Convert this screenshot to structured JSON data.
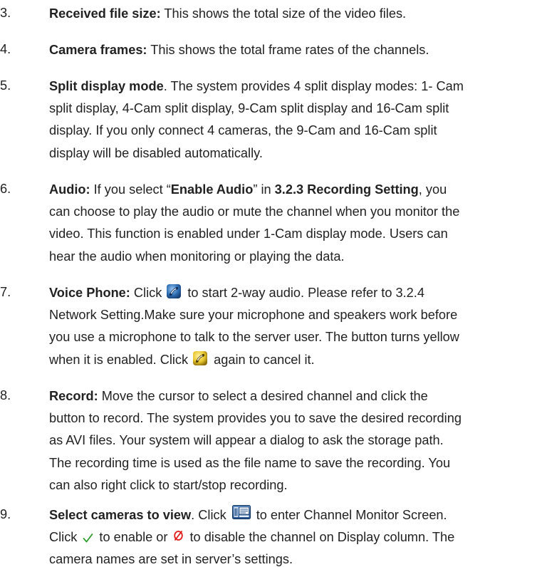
{
  "colors": {
    "text": "#222222",
    "check_green": "#2e9e2e",
    "disable_red": "#e21b1b",
    "phone_blue": "#2f6fb5",
    "phone_yellow": "#e8c62c"
  },
  "icons": {
    "voice_phone": "voice-phone-icon",
    "voice_phone_active": "voice-phone-active-icon",
    "monitor": "channel-monitor-icon",
    "check": "check-icon",
    "disable": "disable-icon"
  },
  "items": [
    {
      "number": "3.",
      "lines": [
        {
          "label": "Received file size:",
          "text": " This shows the total size of the video files."
        }
      ]
    },
    {
      "number": "4.",
      "lines": [
        {
          "label": "Camera frames:",
          "text": " This shows the total frame rates of the channels."
        }
      ]
    },
    {
      "number": "5.",
      "lines": [
        {
          "label": "Split display mode",
          "text": ". The system provides 4 split display modes: 1- Cam"
        },
        {
          "text": "split display, 4-Cam split display, 9-Cam split display and 16-Cam split"
        },
        {
          "text": "display. If you only connect 4 cameras, the 9-Cam and 16-Cam split"
        },
        {
          "text": "display will be disabled automatically."
        }
      ]
    },
    {
      "number": "6.",
      "lines": [
        {
          "label": "Audio:",
          "t1": " If you select “",
          "b1": "Enable Audio",
          "t2": "” in ",
          "b2": "3.2.3 Recording Setting",
          "t3": ", you"
        },
        {
          "text": "can choose to play the audio or mute the channel when you monitor the"
        },
        {
          "text": "video. This function is enabled under 1-Cam display mode. Users can"
        },
        {
          "text": "hear the audio when monitoring or playing the data."
        }
      ]
    },
    {
      "number": "7.",
      "lines": [
        {
          "label": "Voice Phone:",
          "t1": " Click",
          "t2": "to start 2-way audio. Please refer to 3.2.4"
        },
        {
          "text": "Network Setting.Make sure your microphone and speakers work before"
        },
        {
          "text": "you use a microphone to talk to the server user. The button turns yellow"
        },
        {
          "t1": "when it is enabled. Click",
          "t2": "again to cancel it."
        }
      ]
    },
    {
      "number": "8.",
      "lines": [
        {
          "label": "Record:",
          "text": " Move the cursor to select a desired channel and click the"
        },
        {
          "text": "button to record. The system provides you to save the desired recording"
        },
        {
          "text": "as AVI files. Your system will appear a dialog to ask the storage path."
        },
        {
          "text": "The recording time is used as the file name to save the recording. You"
        },
        {
          "text": "can also right click to start/stop recording."
        }
      ]
    },
    {
      "number": "9.",
      "lines": [
        {
          "label": "Select cameras to view",
          "t1": ". Click",
          "t2": "to enter Channel Monitor Screen."
        },
        {
          "t1": "Click",
          "t2": "to enable or",
          "t3": "to disable the channel on Display column. The"
        },
        {
          "text": "camera names are set in server’s settings."
        }
      ]
    }
  ]
}
